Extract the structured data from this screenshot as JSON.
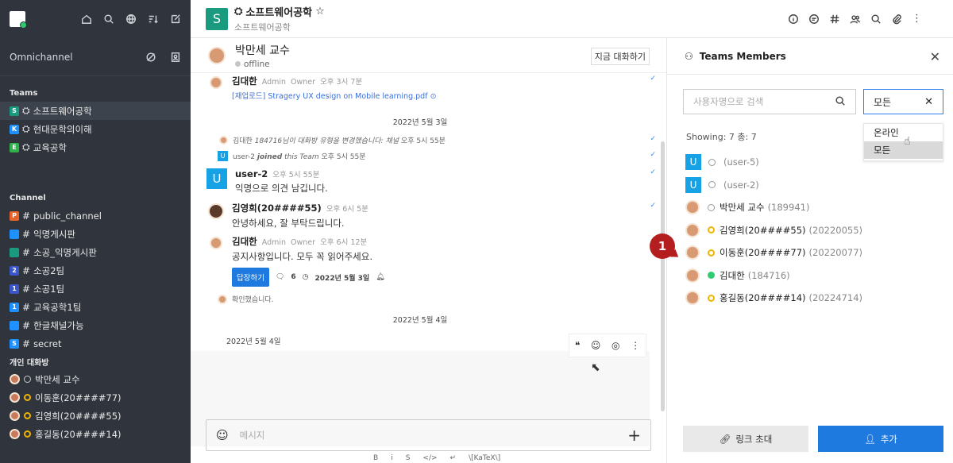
{
  "sidebar": {
    "org_name": "Omnichannel",
    "sections": {
      "teams": "Teams",
      "channel": "Channel",
      "dm": "개인 대화방"
    },
    "teams": [
      {
        "badge": "S",
        "color": "#1a9a7f",
        "label": "소프트웨어공학",
        "active": true
      },
      {
        "badge": "K",
        "color": "#1e90ff",
        "label": "현대문학의이해"
      },
      {
        "badge": "E",
        "color": "#2db34a",
        "label": "교육공학"
      }
    ],
    "channels": [
      {
        "badge": "P",
        "color": "#e8632a",
        "label": "public_channel"
      },
      {
        "badge": "",
        "color": "#1e90ff",
        "label": "익명게시판"
      },
      {
        "badge": "",
        "color": "#1a9a7f",
        "label": "소공_익명게시판"
      },
      {
        "badge": "2",
        "color": "#3a56c9",
        "label": "소공2팀"
      },
      {
        "badge": "1",
        "color": "#3a56c9",
        "label": "소공1팀"
      },
      {
        "badge": "1",
        "color": "#1e90ff",
        "label": "교육공학1팀"
      },
      {
        "badge": "",
        "color": "#1e90ff",
        "label": "한글채널가능"
      },
      {
        "badge": "S",
        "color": "#1e90ff",
        "label": "secret"
      }
    ],
    "dms": [
      {
        "label": "박만세 교수",
        "status": "offline"
      },
      {
        "label": "이동훈(20####77)",
        "status": "away"
      },
      {
        "label": "김영희(20####55)",
        "status": "away"
      },
      {
        "label": "홍길동(20####14)",
        "status": "away"
      }
    ]
  },
  "header": {
    "team_logo": "S",
    "title": "소프트웨어공학",
    "subtitle": "소프트웨어공학"
  },
  "chat": {
    "peer_name": "박만세 교수",
    "peer_status": "offline",
    "talk_now": "지금 대화하기",
    "messages": {
      "m1": {
        "author": "김대한",
        "role": "Admin",
        "owner": "Owner",
        "time": "오후 3시 7분",
        "link": "[재업로드] Stragery UX design on Mobile learning.pdf"
      },
      "date1": "2022년 5월 3일",
      "sys1": {
        "text_pre": "김대한",
        "text_italic": "184716님이 대화방 유형을 변경했습니다: 채널",
        "time": "오후 5시 55분"
      },
      "sys2": {
        "text_pre": "user-2",
        "bold": "joined",
        "italic": "this Team",
        "time": "오후 5시 55분"
      },
      "m2": {
        "badge": "U",
        "author": "user-2",
        "time": "오후 5시 55분",
        "text": "익명으로 의견 남깁니다."
      },
      "m3": {
        "author": "김영희(20####55)",
        "time": "오후 6시 5분",
        "text": "안녕하세요, 잘 부탁드립니다."
      },
      "m4": {
        "author": "김대한",
        "role": "Admin",
        "owner": "Owner",
        "time": "오후 6시 12분",
        "text": "공지사항입니다. 모두 꼭 읽어주세요.",
        "reply": "답장하기",
        "reply_count": "6",
        "reply_date": "2022년 5월 3일"
      },
      "m5": {
        "text": "확인했습니다."
      },
      "date2": "2022년 5월 4일",
      "date3": "2022년 5월 4일"
    },
    "composer_placeholder": "메시지",
    "format_bar": [
      "B",
      "i",
      "S",
      "</>",
      "↵",
      "\\[KaTeX\\]"
    ]
  },
  "panel": {
    "title": "Teams Members",
    "search_placeholder": "사용자명으로 검색",
    "filter_value": "모든",
    "filter_options": [
      "온라인",
      "모든"
    ],
    "showing": "Showing: 7  총: 7",
    "members": [
      {
        "badge": "U",
        "name": "",
        "id": "(user-5)",
        "status": "offline"
      },
      {
        "badge": "U",
        "name": "",
        "id": "(user-2)",
        "status": "offline"
      },
      {
        "badge": "",
        "name": "박만세 교수",
        "id": "(189941)",
        "status": "offline"
      },
      {
        "badge": "",
        "name": "김영희(20####55)",
        "id": "(20220055)",
        "status": "away"
      },
      {
        "badge": "",
        "name": "이동훈(20####77)",
        "id": "(20220077)",
        "status": "away"
      },
      {
        "badge": "",
        "name": "김대한",
        "id": "(184716)",
        "status": "online"
      },
      {
        "badge": "",
        "name": "홍길동(20####14)",
        "id": "(20224714)",
        "status": "away"
      }
    ],
    "invite_label": "링크 초대",
    "add_label": "추가"
  },
  "callout": "1",
  "colors": {
    "accent": "#1f7ae0",
    "away": "#f0b400",
    "online": "#2ecc71",
    "callout": "#b41e1e"
  }
}
